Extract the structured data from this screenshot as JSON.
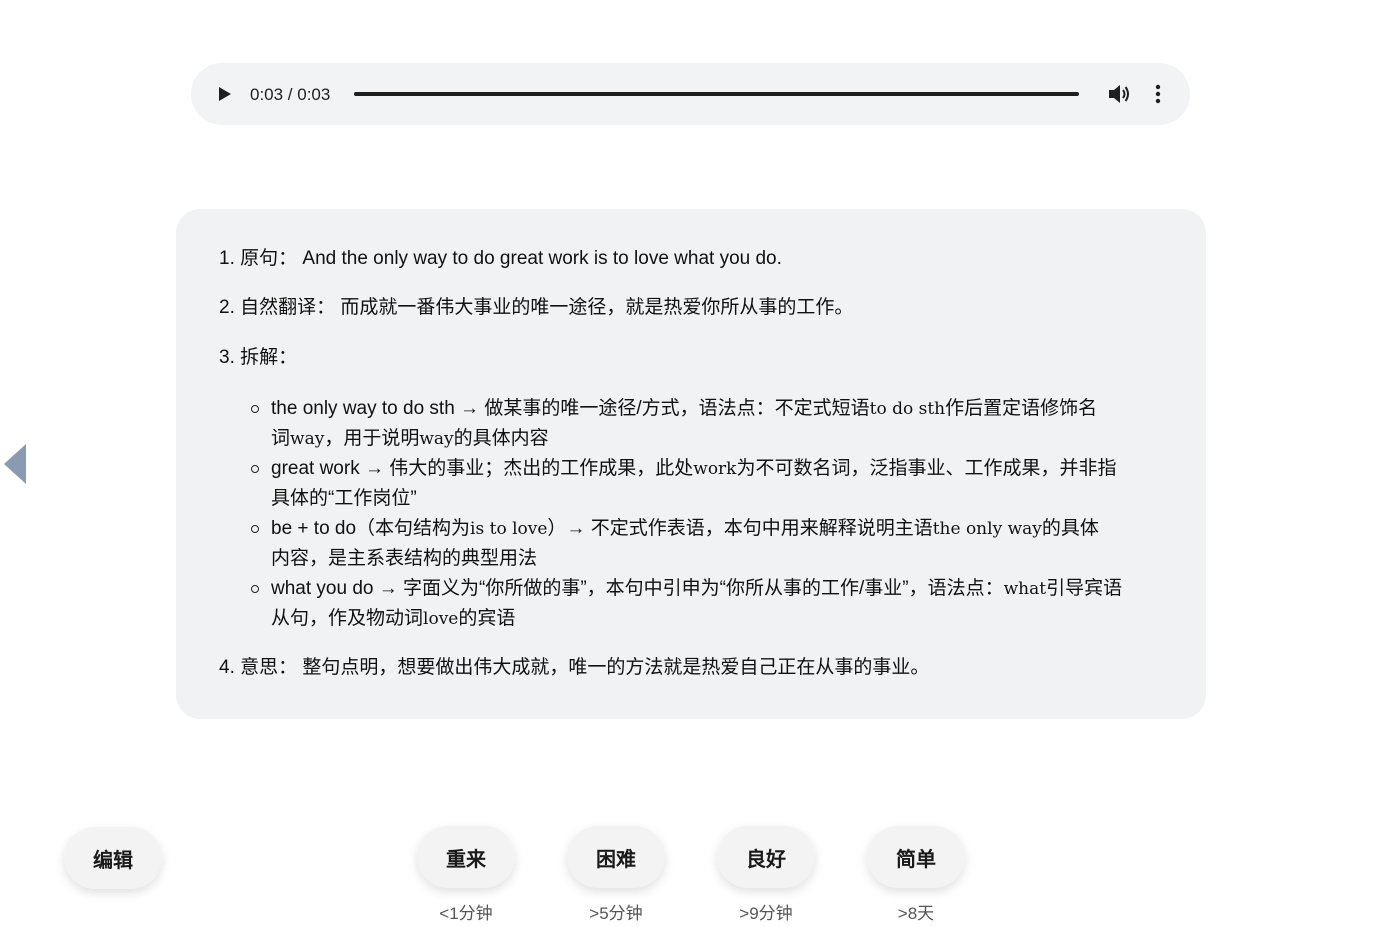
{
  "player": {
    "time": "0:03 / 0:03",
    "progress_fraction": 1.0,
    "icons": [
      "play-icon",
      "volume-icon",
      "more-vert-icon"
    ]
  },
  "card": {
    "item1": {
      "label": "1. 原句：",
      "text": "And the only way to do great work is to love what you do."
    },
    "item2": {
      "label": "2. 自然翻译：",
      "text": "而成就一番伟大事业的唯一途径，就是热爱你所从事的工作。"
    },
    "item3": {
      "label": "3. 拆解："
    },
    "subitems": [
      {
        "line1_a": "the only way to do sth → 做某事的唯一途径/方式，语法点：不定式短语",
        "line1_code": "to do sth",
        "line1_b": "作后置定语修饰名",
        "line2_a": "词",
        "line2_code": "way",
        "line2_b": "，用于说明",
        "line2_code2": "way",
        "line2_c": "的具体内容"
      },
      {
        "line1_a": "great work → 伟大的事业；杰出的工作成果，此处",
        "line1_code": "work",
        "line1_b": "为不可数名词，泛指事业、工作成果，并非指",
        "line2_a": "具体的“工作岗位”"
      },
      {
        "line1_a": "be + to do（本句结构为",
        "line1_code": "is to love",
        "line1_b": "）→ 不定式作表语，本句中用来解释说明主语",
        "line1_code2": "the only way",
        "line1_c": "的具体",
        "line2_a": "内容，是主系表结构的典型用法"
      },
      {
        "line1_a": "what you do → 字面义为“你所做的事”，本句中引申为“你所从事的工作/事业”，语法点：",
        "line1_code": "what",
        "line1_b": "引导宾语",
        "line2_a": "从句，作及物动词",
        "line2_code": "love",
        "line2_b": "的宾语"
      }
    ],
    "item4": {
      "label": "4. 意思：",
      "text": "整句点明，想要做出伟大成就，唯一的方法就是热爱自己正在从事的事业。"
    }
  },
  "buttons": {
    "edit": "编辑",
    "again": {
      "label": "重来",
      "caption": "<1分钟"
    },
    "hard": {
      "label": "困难",
      "caption": ">5分钟"
    },
    "good": {
      "label": "良好",
      "caption": ">9分钟"
    },
    "easy": {
      "label": "简单",
      "caption": ">8天"
    }
  },
  "colors": {
    "card_bg": "#f1f2f3",
    "player_bg": "#f1f3f4",
    "arrow": "#8a9ab0"
  }
}
